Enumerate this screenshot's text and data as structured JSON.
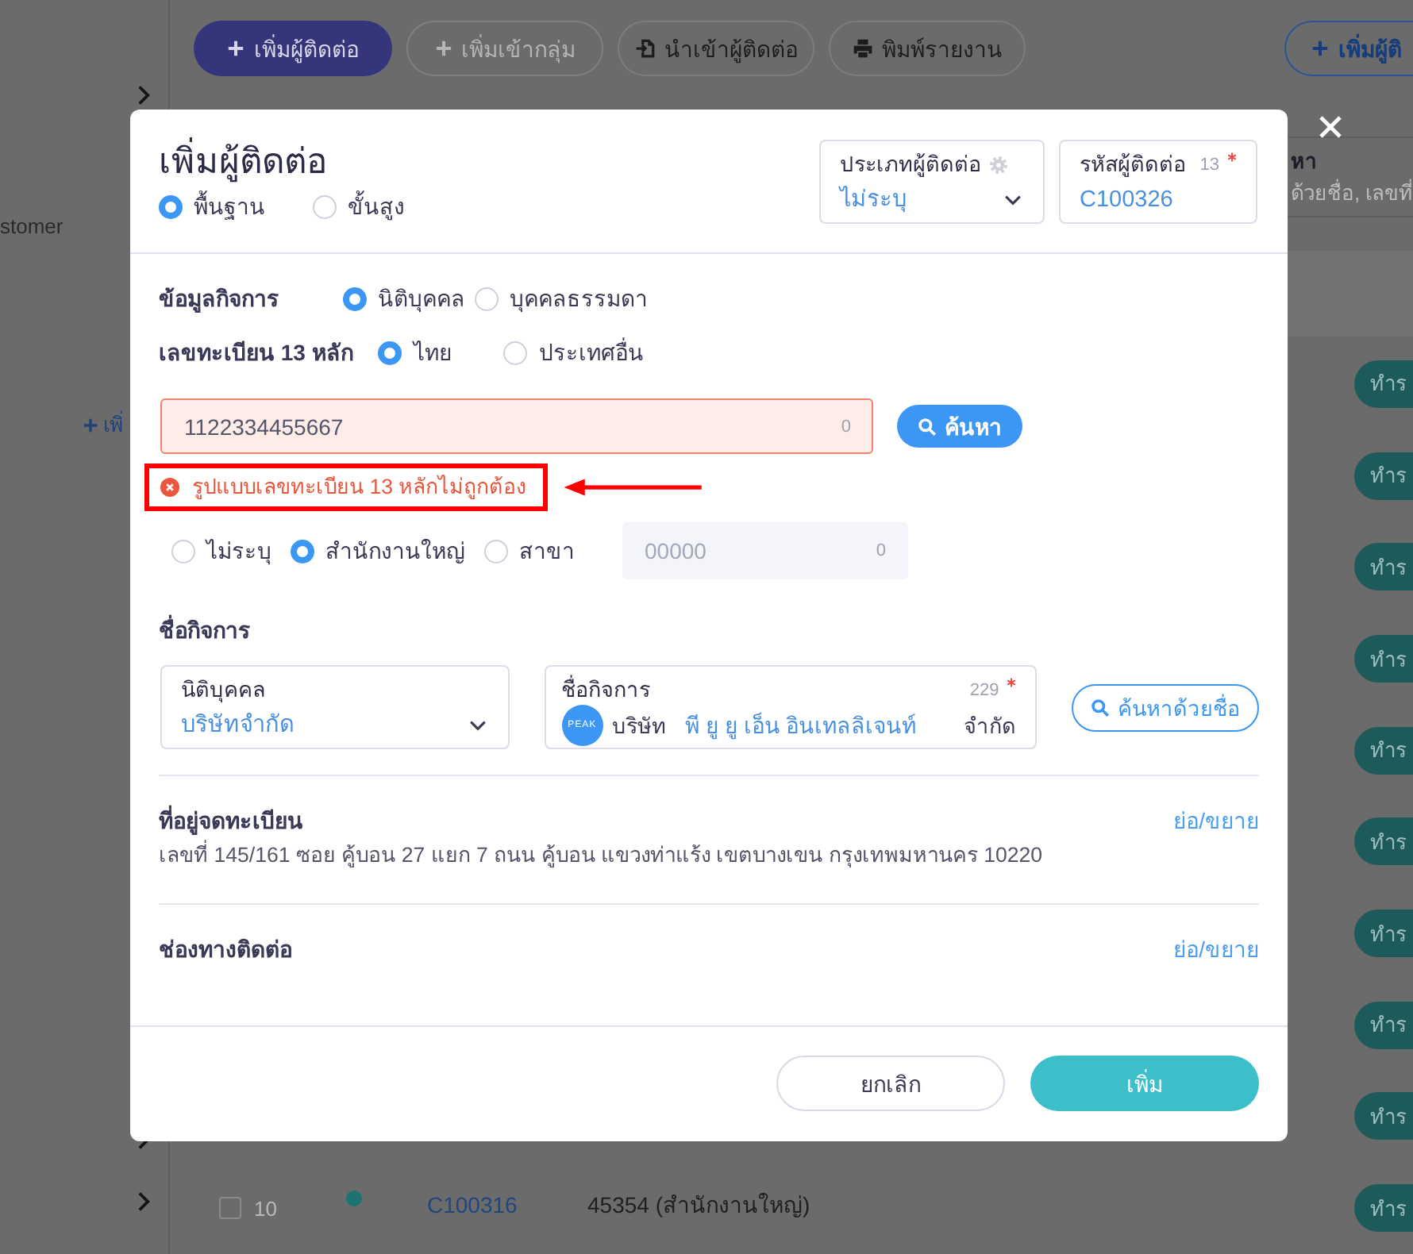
{
  "sidebar": {
    "item": "stomer",
    "add_label": "เพิ่"
  },
  "toolbar": {
    "buttons": [
      {
        "label": "เพิ่มผู้ติดต่อ",
        "kind": "primary",
        "disabled": false
      },
      {
        "label": "เพิ่มเข้ากลุ่ม",
        "kind": "outline",
        "disabled": true
      },
      {
        "label": "นำเข้าผู้ติดต่อ",
        "kind": "outline",
        "disabled": false
      },
      {
        "label": "พิมพ์รายงาน",
        "kind": "outline",
        "disabled": false
      },
      {
        "label": "เพิ่มผู้ติ",
        "kind": "link",
        "disabled": false
      }
    ]
  },
  "search": {
    "label": "หา",
    "placeholder": "ด้วยชื่อ, เลขที่"
  },
  "table": {
    "rows": [
      {
        "action": "ทำร"
      },
      {
        "action": "ทำร"
      },
      {
        "action": "ทำร"
      },
      {
        "action": "ทำร"
      },
      {
        "action": "ทำร"
      },
      {
        "action": "ทำร"
      },
      {
        "action": "ทำร"
      },
      {
        "action": "ทำร"
      },
      {
        "action": "ทำร"
      },
      {
        "checked": false,
        "number": "10",
        "color": "#1f7272",
        "code": "C100316",
        "branch": "45354 (สำนักงานใหญ่)",
        "action": "ทำร"
      }
    ]
  },
  "modal": {
    "title": "เพิ่มผู้ติดต่อ",
    "mode_options": [
      {
        "label": "พื้นฐาน",
        "selected": true
      },
      {
        "label": "ขั้นสูง",
        "selected": false
      }
    ],
    "contact_type": {
      "label": "ประเภทผู้ติดต่อ",
      "value": "ไม่ระบุ"
    },
    "contact_code": {
      "label": "รหัสผู้ติดต่อ",
      "counter": "13",
      "required": true,
      "value": "C100326"
    },
    "business_info": {
      "label": "ข้อมูลกิจการ",
      "options": [
        {
          "label": "นิติบุคคล",
          "selected": true
        },
        {
          "label": "บุคคลธรรมดา",
          "selected": false
        }
      ]
    },
    "tax_id": {
      "label": "เลขทะเบียน 13 หลัก",
      "options": [
        {
          "label": "ไทย",
          "selected": true
        },
        {
          "label": "ประเทศอื่น",
          "selected": false
        }
      ],
      "value": "1122334455667",
      "counter": "0",
      "invalid": true,
      "search_button": "ค้นหา",
      "error": "รูปแบบเลขทะเบียน 13 หลักไม่ถูกต้อง",
      "highlighted": true
    },
    "branch": {
      "options": [
        {
          "label": "ไม่ระบุ",
          "selected": false
        },
        {
          "label": "สำนักงานใหญ่",
          "selected": true
        },
        {
          "label": "สาขา",
          "selected": false
        }
      ],
      "placeholder": "00000",
      "counter": "0"
    },
    "business_name": {
      "label": "ชื่อกิจการ",
      "entity_type": {
        "label": "นิติบุคคล",
        "value": "บริษัทจำกัด"
      },
      "name_field": {
        "label": "ชื่อกิจการ",
        "counter": "229",
        "required": true,
        "logo": "PEAK",
        "prefix": "บริษัท",
        "value": "พี ยู ยู เอ็น อินเทลลิเจนท์",
        "suffix": "จำกัด"
      },
      "search_button": "ค้นหาด้วยชื่อ"
    },
    "sections": [
      {
        "title": "ที่อยู่จดทะเบียน",
        "toggle": "ย่อ/ขยาย",
        "text": "เลขที่ 145/161 ซอย คู้บอน 27 แยก 7 ถนน คู้บอน แขวงท่าแร้ง เขตบางเขน กรุงเทพมหานคร 10220"
      },
      {
        "title": "ช่องทางติดต่อ",
        "toggle": "ย่อ/ขยาย"
      }
    ],
    "buttons": [
      {
        "label": "ยกเลิก",
        "kind": "secondary"
      },
      {
        "label": "เพิ่ม",
        "kind": "primary"
      }
    ]
  }
}
